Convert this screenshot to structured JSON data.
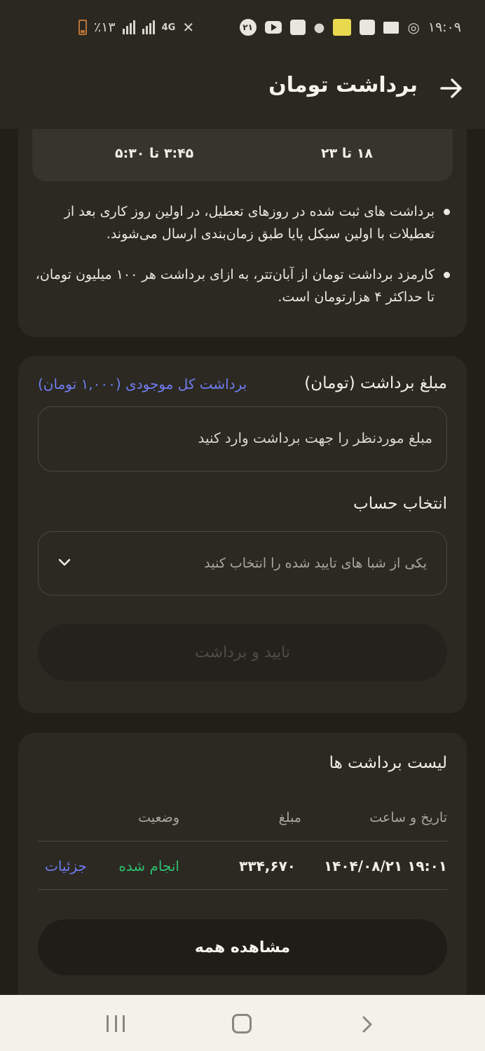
{
  "status_bar": {
    "battery": "٪۱۳",
    "network": "4G",
    "notification_badge": "۲۱",
    "time": "۱۹:۰۹"
  },
  "header": {
    "title": "برداشت تومان",
    "back_icon": "arrow-right-icon"
  },
  "schedule": {
    "range_a": "۱۸ تا ۲۳",
    "range_b": "۳:۴۵ تا ۵:۳۰"
  },
  "notes": [
    "برداشت های ثبت شده در روزهای تعطیل، در اولین روز کاری بعد از تعطیلات با اولین سیکل پایا طبق زمان‌بندی ارسال می‌شوند.",
    "کارمزد برداشت تومان از آبان‌تتر، به ازای برداشت هر ۱۰۰ میلیون تومان، تا حداکثر ۴ هزارتومان است."
  ],
  "form": {
    "amount_label": "مبلغ برداشت (تومان)",
    "withdraw_all": "برداشت کل موجودی (۱,۰۰۰ تومان)",
    "amount_placeholder": "مبلغ موردنظر را جهت برداشت وارد کنید",
    "account_label": "انتخاب حساب",
    "account_placeholder": "یکی از شبا های تایید شده را انتخاب کنید",
    "confirm_button": "تایید و برداشت"
  },
  "history": {
    "title": "لیست برداشت ها",
    "columns": {
      "date": "تاریخ و ساعت",
      "amount": "مبلغ",
      "status": "وضعیت"
    },
    "rows": [
      {
        "date": "۱۴۰۴/۰۸/۲۱ ۱۹:۰۱",
        "amount": "۳۳۴,۶۷۰",
        "status": "انجام شده",
        "details": "جزئیات"
      }
    ],
    "view_all": "مشاهده همه"
  },
  "colors": {
    "background": "#211f18",
    "card": "#2b2921",
    "link": "#6f7cf0",
    "success": "#2fbf71"
  }
}
